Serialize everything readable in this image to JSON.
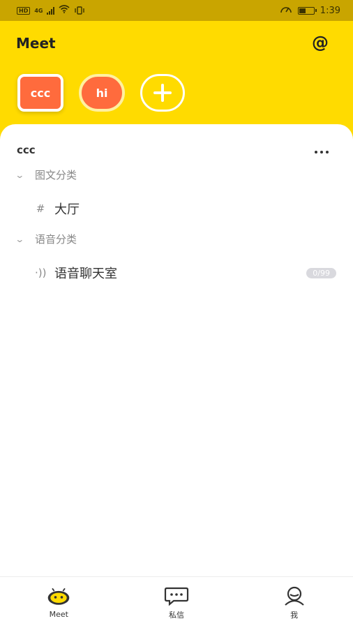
{
  "status_bar": {
    "network_hd": "HD",
    "network_type": "4G",
    "time": "1:39",
    "battery_level_fraction": 0.45
  },
  "header": {
    "title": "Meet",
    "at_icon": "@",
    "servers": [
      {
        "label": "ccc",
        "active": true
      },
      {
        "label": "hi",
        "active": false
      }
    ],
    "add_server_icon": "plus-icon"
  },
  "panel": {
    "server_name": "ccc",
    "more_icon": "more-horizontal-icon",
    "categories": [
      {
        "name": "图文分类",
        "channels": [
          {
            "icon": "#",
            "name": "大厅"
          }
        ]
      },
      {
        "name": "语音分类",
        "channels": [
          {
            "icon": "·))",
            "name": "语音聊天室",
            "badge": "0/99"
          }
        ]
      }
    ]
  },
  "bottom_nav": {
    "items": [
      {
        "label": "Meet",
        "icon": "meet-robot-icon"
      },
      {
        "label": "私信",
        "icon": "chat-bubble-icon"
      },
      {
        "label": "我",
        "icon": "profile-icon"
      }
    ]
  },
  "colors": {
    "accent_yellow": "#ffdb00",
    "server_orange": "#ff6b3d",
    "status_bar": "#c9a500"
  }
}
